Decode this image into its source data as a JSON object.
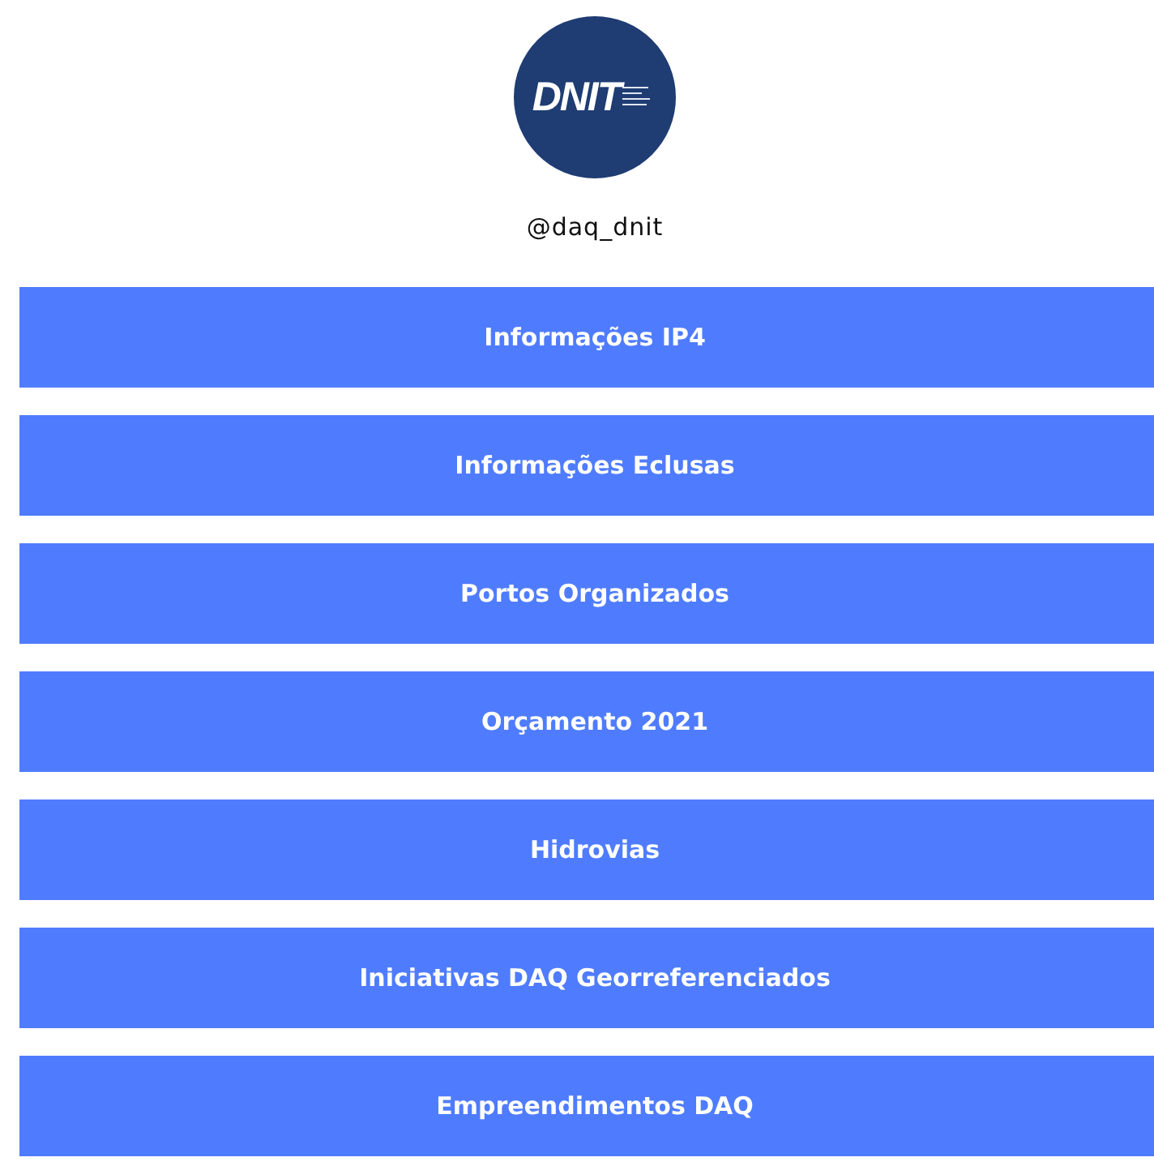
{
  "profile": {
    "logo_text": "DNIT",
    "handle": "@daq_dnit"
  },
  "links": [
    {
      "label": "Informações IP4"
    },
    {
      "label": "Informações Eclusas"
    },
    {
      "label": "Portos Organizados"
    },
    {
      "label": "Orçamento 2021"
    },
    {
      "label": "Hidrovias"
    },
    {
      "label": "Iniciativas DAQ Georreferenciados"
    },
    {
      "label": "Empreendimentos DAQ"
    }
  ]
}
